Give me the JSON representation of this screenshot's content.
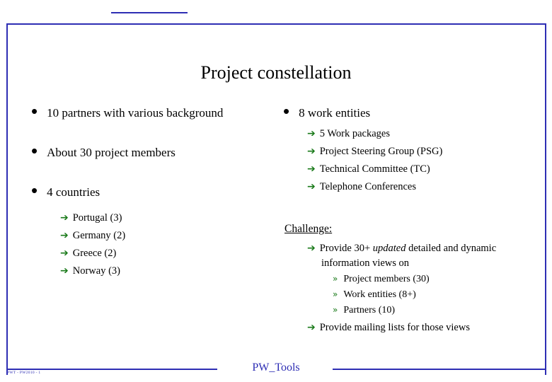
{
  "slide": {
    "title": "Project constellation",
    "footer_center": "PW_Tools",
    "footer_left": "PWT - PW2010 - 1",
    "accent_color": "#2e2eb4",
    "arrow_color": "#1a7a1a",
    "left_column": [
      {
        "text": "10 partners with various background"
      },
      {
        "text": "About 30 project members"
      },
      {
        "text": "4 countries"
      }
    ],
    "countries": [
      {
        "text": "Portugal (3)"
      },
      {
        "text": "Germany (2)"
      },
      {
        "text": "Greece  (2)"
      },
      {
        "text": "Norway (3)"
      }
    ],
    "right_heading": "8 work entities",
    "work_entities": [
      {
        "text": "5 Work packages"
      },
      {
        "text": "Project Steering Group (PSG)"
      },
      {
        "text": "Technical Committee (TC)"
      },
      {
        "text": "Telephone Conferences"
      }
    ],
    "challenge_heading": "Challenge:",
    "challenge_items": {
      "provide_prefix": "Provide 30+ ",
      "provide_italic": "updated",
      "provide_suffix": " detailed and dynamic",
      "provide_line2": "information views on",
      "sub_items": [
        {
          "text": "Project members (30)"
        },
        {
          "text": "Work entities (8+)"
        },
        {
          "text": "Partners (10)"
        }
      ],
      "mailing": "Provide mailing lists for those views"
    },
    "icons": {
      "bullet": "•",
      "arrow": "➔",
      "chevrons": "»"
    }
  }
}
